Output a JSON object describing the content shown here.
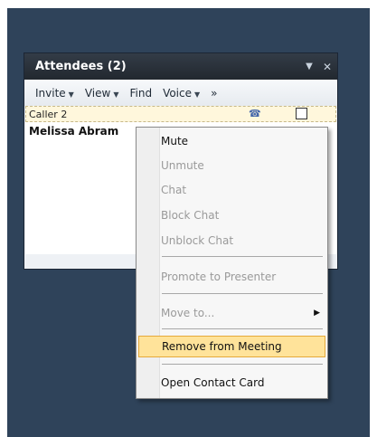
{
  "window": {
    "title": "Attendees (2)",
    "dropdown_icon": "chevron-down-icon",
    "close_icon": "close-icon"
  },
  "toolbar": {
    "items": [
      {
        "label": "Invite",
        "has_dropdown": true
      },
      {
        "label": "View",
        "has_dropdown": true
      },
      {
        "label": "Find",
        "has_dropdown": false
      },
      {
        "label": "Voice",
        "has_dropdown": true
      },
      {
        "label": "»",
        "has_dropdown": false
      }
    ]
  },
  "attendees": [
    {
      "name": "Caller 2",
      "selected": true,
      "icon": "phone-icon",
      "checked": false
    },
    {
      "name": "Melissa Abram",
      "selected": false
    }
  ],
  "context_menu": {
    "items": [
      {
        "label": "Mute",
        "enabled": true
      },
      {
        "label": "Unmute",
        "enabled": false
      },
      {
        "label": "Chat",
        "enabled": false
      },
      {
        "label": "Block Chat",
        "enabled": false
      },
      {
        "label": "Unblock Chat",
        "enabled": false
      },
      {
        "label": "Promote to Presenter",
        "enabled": false
      },
      {
        "label": "Move to...",
        "enabled": false,
        "submenu": true
      },
      {
        "label": "Remove from Meeting",
        "enabled": true,
        "highlighted": true
      },
      {
        "label": "Open Contact Card",
        "enabled": true
      }
    ]
  },
  "colors": {
    "desktop": "#2f435a",
    "titlebar": "#2a3038",
    "highlight": "#ffe39a"
  }
}
